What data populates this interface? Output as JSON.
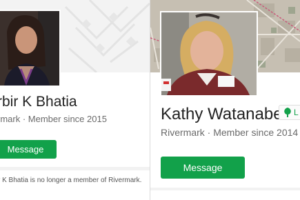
{
  "left_profile": {
    "name": "rbir K Bhatia",
    "subtitle": "rmark · Member since 2015",
    "message_button": "Message",
    "notice": "r K Bhatia is no longer a member of Rivermark."
  },
  "right_profile": {
    "name": "Kathy Watanabe",
    "subtitle": "Rivermark · Member since 2014",
    "message_button": "Message",
    "badge": {
      "text": "L",
      "icon": "tree-icon"
    }
  },
  "colors": {
    "accent_green": "#12a14a"
  }
}
